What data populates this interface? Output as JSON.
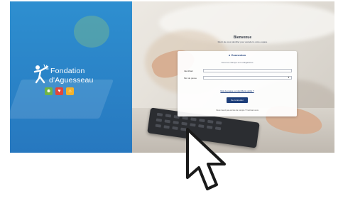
{
  "brand": {
    "line1": "Fondation",
    "line2": "d'Aguesseau",
    "logo_icon": "person-star-icon",
    "tiles": [
      {
        "color": "#6fb445",
        "icon": "people-icon"
      },
      {
        "color": "#e2473b",
        "icon": "heart-icon"
      },
      {
        "color": "#f3b22b",
        "icon": "house-icon"
      }
    ],
    "panel_color": "#2b86c9"
  },
  "login": {
    "title": "Bienvenue",
    "subtitle": "Merci de vous identifier pour accéder à votre espace",
    "card_title": "Connexion",
    "hint": "Tous les champs sont obligatoires",
    "fields": [
      {
        "label": "Identifiant",
        "value": ""
      },
      {
        "label": "Mot de passe",
        "value": ""
      }
    ],
    "forgot_link": "Mot de passe ou identifiant oublié ?",
    "submit_label": "Se connecter",
    "footer": "Vous n'avez pas encore de compte ? Inscrivez-vous",
    "accent": "#1d3e7a"
  },
  "cursor": "arrow-cursor-icon"
}
